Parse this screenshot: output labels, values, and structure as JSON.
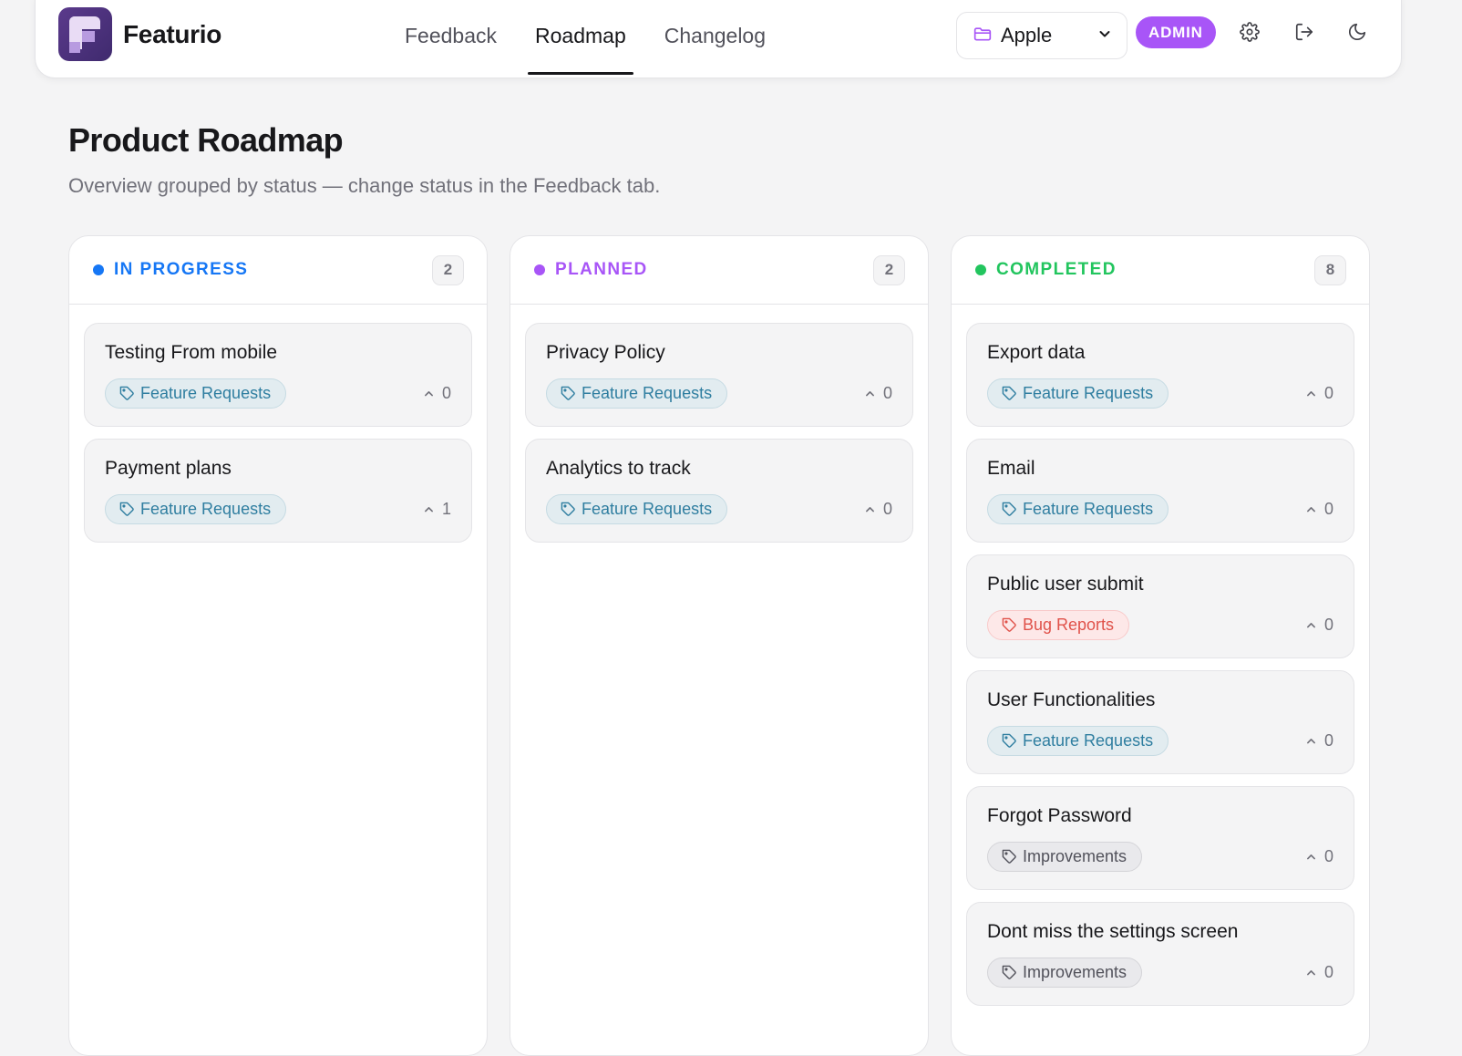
{
  "app": {
    "brand": "Featurio"
  },
  "nav": {
    "items": [
      {
        "label": "Feedback",
        "active": false
      },
      {
        "label": "Roadmap",
        "active": true
      },
      {
        "label": "Changelog",
        "active": false
      }
    ]
  },
  "header": {
    "project": "Apple",
    "role_badge": "ADMIN",
    "icons": [
      "folder-icon",
      "chevron-down-icon",
      "gear-icon",
      "logout-icon",
      "moon-icon"
    ]
  },
  "page": {
    "title": "Product Roadmap",
    "subtitle": "Overview grouped by status — change status in the Feedback tab."
  },
  "colors": {
    "in_progress": "#1677f5",
    "planned": "#a855f7",
    "completed": "#22c55e",
    "admin": "#a855f7"
  },
  "columns": [
    {
      "title": "IN PROGRESS",
      "count": "2",
      "cards": [
        {
          "title": "Testing From mobile",
          "tag": "Feature Requests",
          "votes": "0"
        },
        {
          "title": "Payment plans",
          "tag": "Feature Requests",
          "votes": "1"
        }
      ]
    },
    {
      "title": "PLANNED",
      "count": "2",
      "cards": [
        {
          "title": "Privacy Policy",
          "tag": "Feature Requests",
          "votes": "0"
        },
        {
          "title": "Analytics to track",
          "tag": "Feature Requests",
          "votes": "0"
        }
      ]
    },
    {
      "title": "COMPLETED",
      "count": "8",
      "cards": [
        {
          "title": "Export data",
          "tag": "Feature Requests",
          "votes": "0"
        },
        {
          "title": "Email",
          "tag": "Feature Requests",
          "votes": "0"
        },
        {
          "title": "Public user submit",
          "tag": "Bug Reports",
          "votes": "0"
        },
        {
          "title": "User Functionalities",
          "tag": "Feature Requests",
          "votes": "0"
        },
        {
          "title": "Forgot Password",
          "tag": "Improvements",
          "votes": "0"
        },
        {
          "title": "Dont miss the settings screen",
          "tag": "Improvements",
          "votes": "0"
        }
      ]
    }
  ]
}
